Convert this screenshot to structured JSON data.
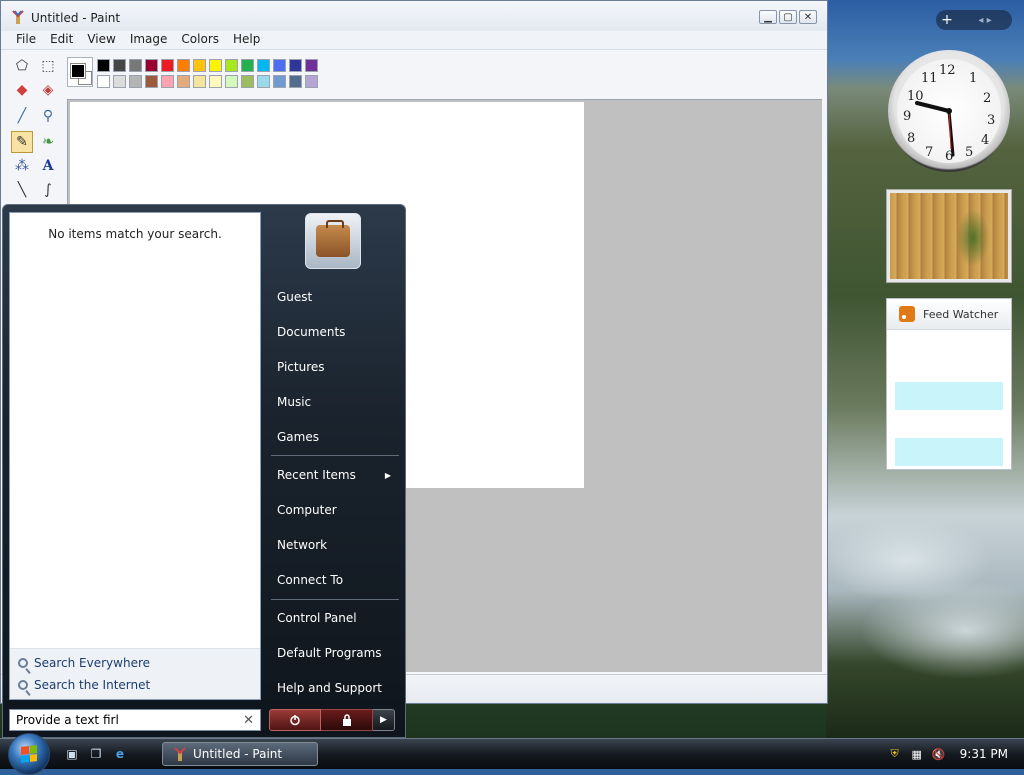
{
  "paint": {
    "title": "Untitled - Paint",
    "menu": [
      "File",
      "Edit",
      "View",
      "Image",
      "Colors",
      "Help"
    ],
    "palette_row1": [
      "#000000",
      "#464646",
      "#787878",
      "#990030",
      "#ed1c24",
      "#ff7e00",
      "#ffc20e",
      "#fff200",
      "#a8e61d",
      "#22b14c",
      "#00b7ef",
      "#4d6df3",
      "#2f3699",
      "#6f3198"
    ],
    "palette_row2": [
      "#ffffff",
      "#dcdcdc",
      "#b4b4b4",
      "#9c5a3c",
      "#ffa3b1",
      "#e5aa7a",
      "#f5e49c",
      "#fff9bd",
      "#d3f9bc",
      "#9dbb61",
      "#99d9ea",
      "#709ad1",
      "#546d8e",
      "#b5a5d5"
    ]
  },
  "gadgets": {
    "clock_numbers": [
      "12",
      "1",
      "2",
      "3",
      "4",
      "5",
      "6",
      "7",
      "8",
      "9",
      "10",
      "11"
    ],
    "feed_title": "Feed Watcher"
  },
  "startmenu": {
    "no_items": "No items match your search.",
    "search_everywhere": "Search Everywhere",
    "search_internet": "Search the Internet",
    "search_value": "Provide a text firl",
    "right_items": [
      "Guest",
      "Documents",
      "Pictures",
      "Music",
      "Games",
      "Recent Items",
      "Computer",
      "Network",
      "Connect To",
      "Control Panel",
      "Default Programs",
      "Help and Support"
    ]
  },
  "taskbar": {
    "task_label": "Untitled - Paint",
    "time": "9:31 PM"
  }
}
